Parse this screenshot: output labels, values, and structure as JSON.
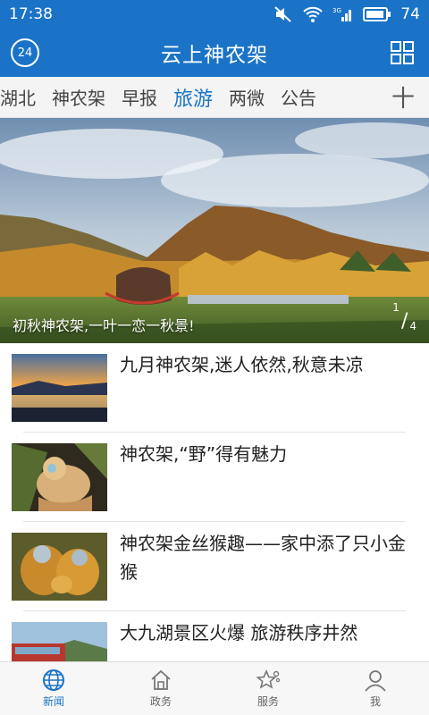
{
  "status_bar": {
    "time": "17:38",
    "battery": "74"
  },
  "app_bar": {
    "title": "云上神农架",
    "badge": "24"
  },
  "tabs": [
    {
      "label": "湖北"
    },
    {
      "label": "神农架"
    },
    {
      "label": "早报"
    },
    {
      "label": "旅游",
      "active": true
    },
    {
      "label": "两微"
    },
    {
      "label": "公告"
    },
    {
      "label": "十"
    }
  ],
  "hero": {
    "caption": "初秋神农架,一叶一恋一秋景!",
    "current": "1",
    "total": "4"
  },
  "articles": [
    {
      "title": "九月神农架,迷人依然,秋意未凉"
    },
    {
      "title": "神农架,“野”得有魅力"
    },
    {
      "title": "神农架金丝猴趣——家中添了只小金猴"
    },
    {
      "title": "大九湖景区火爆 旅游秩序井然"
    }
  ],
  "bottom_nav": [
    {
      "label": "新闻",
      "icon": "globe-icon",
      "active": true
    },
    {
      "label": "政务",
      "icon": "home-icon"
    },
    {
      "label": "服务",
      "icon": "star-icon"
    },
    {
      "label": "我",
      "icon": "person-icon"
    }
  ],
  "colors": {
    "primary": "#1a73c7",
    "tab_bg": "#f4f4f4",
    "nav_bg": "#f7f7f7"
  }
}
